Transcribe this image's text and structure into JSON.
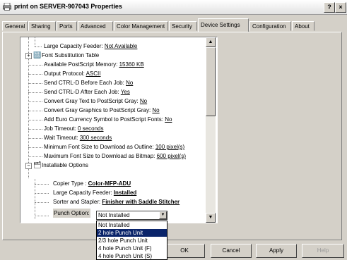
{
  "window": {
    "title": "print on SERVER-907043 Properties",
    "help_label": "?",
    "close_label": "×"
  },
  "tabs": [
    {
      "label": "General"
    },
    {
      "label": "Sharing"
    },
    {
      "label": "Ports"
    },
    {
      "label": "Advanced"
    },
    {
      "label": "Color Management"
    },
    {
      "label": "Security"
    },
    {
      "label": "Device Settings",
      "active": true
    },
    {
      "label": "Configuration"
    },
    {
      "label": "About"
    }
  ],
  "tree": {
    "items": [
      {
        "label": "Large Capacity Feeder: ",
        "value": "Not Available"
      },
      {
        "label": "Font Substitution Table",
        "value": ""
      },
      {
        "label": "Available PostScript Memory: ",
        "value": "15360 KB"
      },
      {
        "label": "Output Protocol: ",
        "value": "ASCII"
      },
      {
        "label": "Send CTRL-D Before Each Job: ",
        "value": "No"
      },
      {
        "label": "Send CTRL-D After Each Job: ",
        "value": "Yes"
      },
      {
        "label": "Convert Gray Text to PostScript Gray: ",
        "value": "No"
      },
      {
        "label": "Convert Gray Graphics to PostScript Gray: ",
        "value": "No"
      },
      {
        "label": "Add Euro Currency Symbol to PostScript Fonts: ",
        "value": "No"
      },
      {
        "label": "Job Timeout: ",
        "value": "0 seconds"
      },
      {
        "label": "Wait Timeout: ",
        "value": "300 seconds"
      },
      {
        "label": "Minimum Font Size to Download as Outline: ",
        "value": "100 pixel(s)"
      },
      {
        "label": "Maximum Font Size to Download as Bitmap: ",
        "value": "600 pixel(s)"
      },
      {
        "label": "Installable Options",
        "value": ""
      },
      {
        "label": "Copier Type : ",
        "value": "Color-MFP-ADU"
      },
      {
        "label": "Large Capacity Feeder: ",
        "value": "Installed"
      },
      {
        "label": "Sorter and Stapler: ",
        "value": "Finisher with Saddle Stitcher"
      },
      {
        "label": "Punch Option:",
        "value": ""
      }
    ]
  },
  "punch_option": {
    "selected": "Not Installed",
    "options": [
      "Not Installed",
      "2 hole Punch Unit",
      "2/3 hole Punch Unit",
      "4 hole Punch Unit (F)",
      "4 hole Punch Unit (S)"
    ],
    "highlighted_index": 1
  },
  "buttons": {
    "ok": "OK",
    "cancel": "Cancel",
    "apply": "Apply",
    "help": "Help"
  }
}
